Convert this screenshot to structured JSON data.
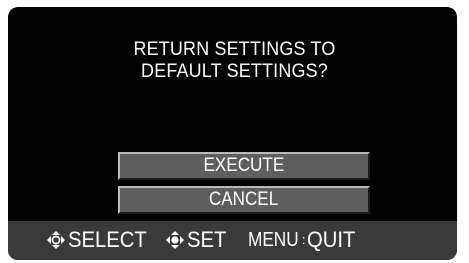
{
  "dialog": {
    "prompt_line1": "RETURN SETTINGS TO",
    "prompt_line2": "DEFAULT SETTINGS?"
  },
  "options": {
    "execute_label": "EXECUTE",
    "cancel_label": "CANCEL"
  },
  "footer": {
    "select_label": "SELECT",
    "set_label": "SET",
    "menu_key": "MENU",
    "separator": ":",
    "quit_label": "QUIT"
  },
  "icons": {
    "select_icon": "dpad-icon",
    "set_icon": "dpad-center-icon"
  },
  "colors": {
    "screen_bg": "#000000",
    "button_bg": "#5e5e5e",
    "footer_bg": "#3a3a3a",
    "text": "#ffffff"
  }
}
